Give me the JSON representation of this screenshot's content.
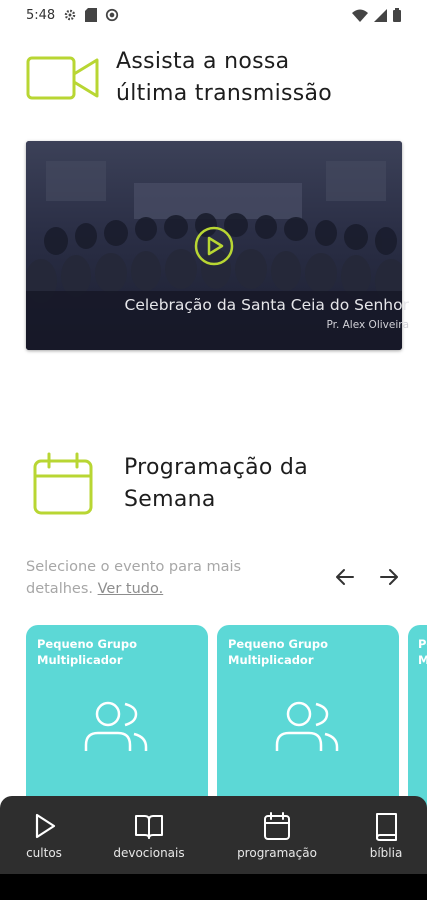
{
  "status": {
    "time": "5:48",
    "left_icons": [
      "gear-icon",
      "sd-card-icon",
      "sync-icon"
    ],
    "right_icons": [
      "wifi-icon",
      "signal-icon",
      "battery-icon"
    ]
  },
  "colors": {
    "accent_lime": "#b8d633",
    "card_teal": "#5cd8d6",
    "nav_dark": "#2e2e2e"
  },
  "broadcast": {
    "icon": "video-camera-icon",
    "title_line1": "Assista a nossa",
    "title_line2": "última transmissão",
    "video_title": "Celebração da Santa Ceia do Senhor",
    "video_speaker": "Pr. Alex Oliveira",
    "play_icon": "play-icon"
  },
  "schedule": {
    "icon": "calendar-icon",
    "title_line1": "Programação da",
    "title_line2": "Semana",
    "hint": "Selecione o evento para mais detalhes. ",
    "see_all": "Ver tudo.",
    "prev_icon": "arrow-left-icon",
    "next_icon": "arrow-right-icon",
    "events": [
      {
        "label": "Pequeno Grupo Multiplicador",
        "icon": "users-icon"
      },
      {
        "label": "Pequeno Grupo Multiplicador",
        "icon": "users-icon"
      },
      {
        "label": "Pequeno Grupo Multiplicador",
        "icon": "users-icon"
      }
    ]
  },
  "nav": {
    "items": [
      {
        "label": "cultos",
        "icon": "play-outline-icon"
      },
      {
        "label": "devocionais",
        "icon": "open-book-icon"
      },
      {
        "label": "programação",
        "icon": "calendar-icon"
      },
      {
        "label": "bíblia",
        "icon": "bible-icon"
      }
    ]
  }
}
